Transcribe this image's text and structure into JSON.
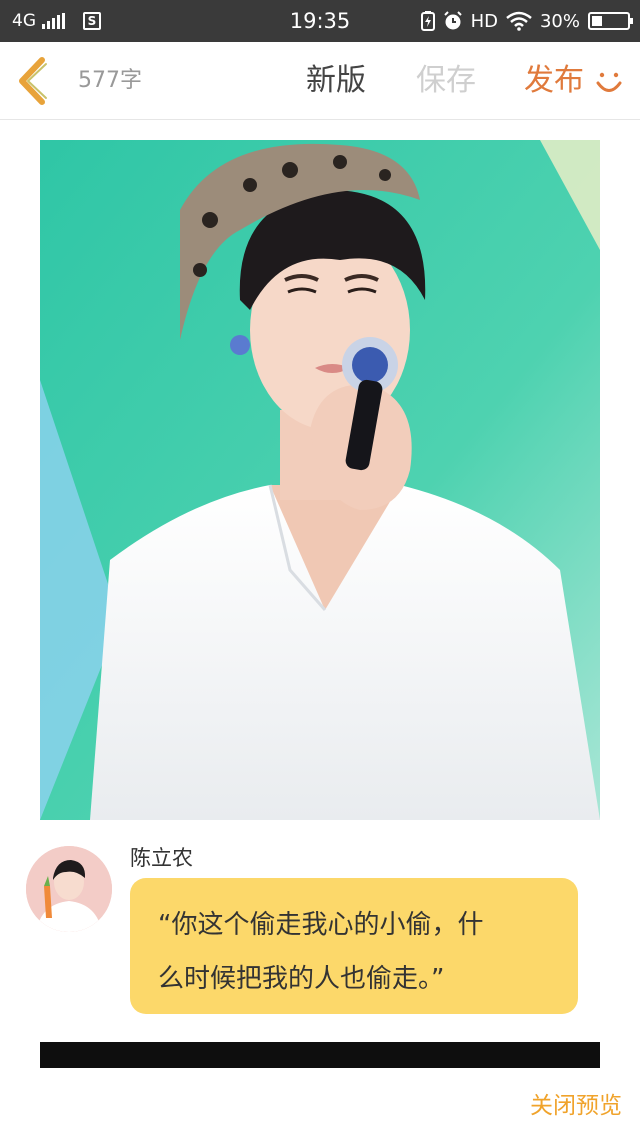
{
  "status_bar": {
    "network": "4G",
    "time": "19:35",
    "hd": "HD",
    "battery_text": "30%",
    "battery_level": 0.3,
    "sim_label": "S",
    "icons": [
      "signal-icon",
      "sim-icon",
      "charging-icon",
      "alarm-icon",
      "wifi-icon",
      "battery-icon"
    ]
  },
  "toolbar": {
    "word_count": "577字",
    "new_version": "新版",
    "save": "保存",
    "publish": "发布",
    "colors": {
      "publish": "#e07a3c",
      "save_disabled": "#cfcfcf",
      "back": "#e8a33a"
    }
  },
  "post": {
    "author": "陈立农",
    "quote_line1": "“你这个偷走我心的小偷，什",
    "quote_line2": "么时候把我的人也偷走。”",
    "bubble_color": "#fcd86a"
  },
  "footer": {
    "close_preview": "关闭预览"
  }
}
